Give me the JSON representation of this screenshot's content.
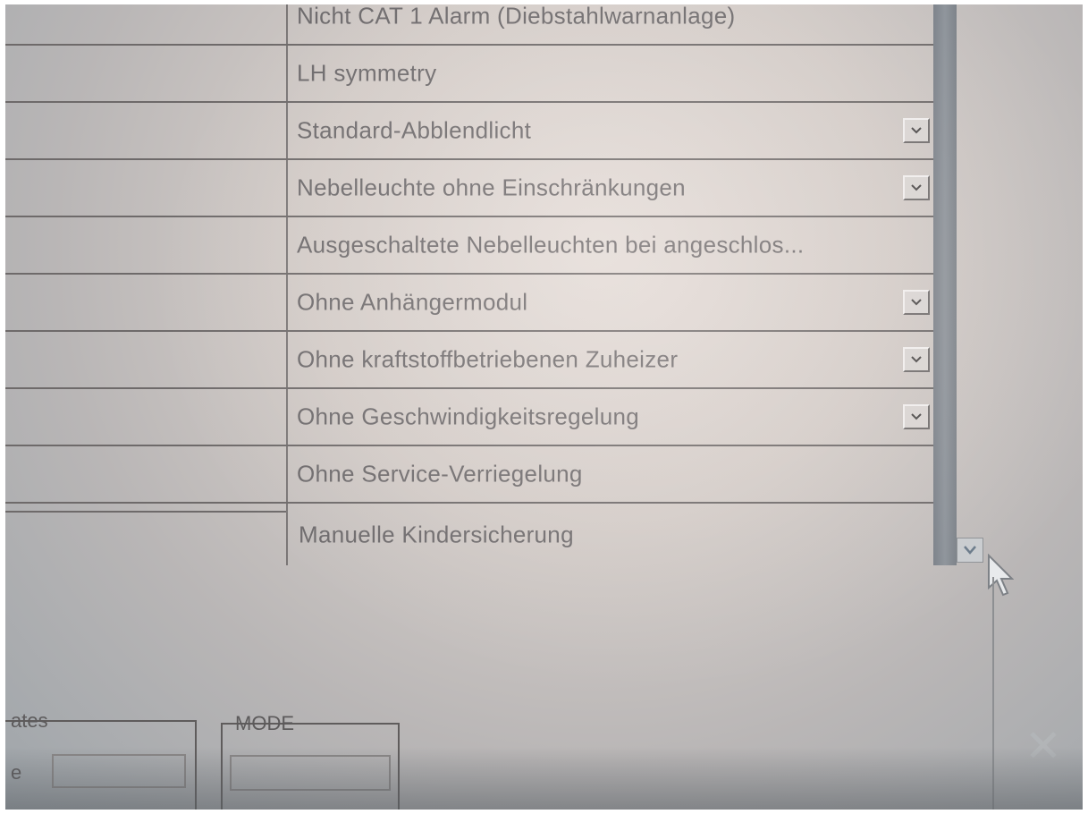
{
  "table": {
    "rows": [
      {
        "value": "Nicht CAT 1 Alarm (Diebstahlwarnanlage)",
        "has_dropdown": false
      },
      {
        "value": "LH symmetry",
        "has_dropdown": false
      },
      {
        "value": "Standard-Abblendlicht",
        "has_dropdown": true
      },
      {
        "value": "Nebelleuchte ohne Einschränkungen",
        "has_dropdown": true
      },
      {
        "value": "Ausgeschaltete Nebelleuchten bei angeschlos...",
        "has_dropdown": false
      },
      {
        "value": "Ohne Anhängermodul",
        "has_dropdown": true
      },
      {
        "value": "Ohne kraftstoffbetriebenen Zuheizer",
        "has_dropdown": true
      },
      {
        "value": "Ohne Geschwindigkeitsregelung",
        "has_dropdown": true
      },
      {
        "value": "Ohne Service-Verriegelung",
        "has_dropdown": false
      },
      {
        "value": "Manuelle Kindersicherung",
        "has_dropdown": false
      }
    ]
  },
  "groups": {
    "left": {
      "legend": "ates",
      "field_label": "e"
    },
    "mode": {
      "legend": "MODE"
    }
  },
  "icons": {
    "dropdown": "chevron-down-icon",
    "scroll_down": "scroll-down-arrow-icon",
    "cursor": "mouse-pointer-icon",
    "close": "close-icon"
  },
  "colors": {
    "scrollbar": "#8d939a",
    "text": "#6d6a6c",
    "grid_lines": "#6e6a6a"
  }
}
